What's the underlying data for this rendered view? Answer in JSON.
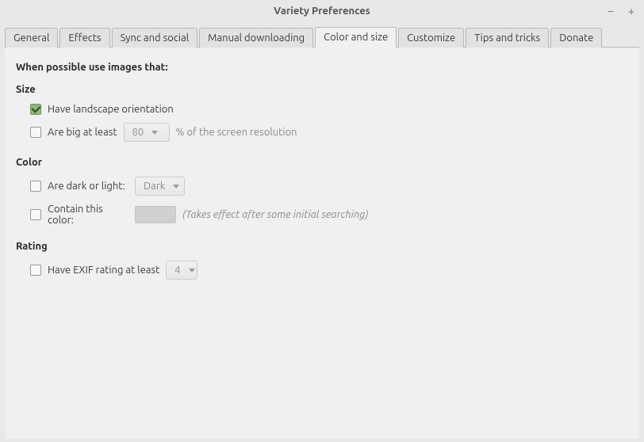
{
  "window": {
    "title": "Variety Preferences"
  },
  "tabs": [
    {
      "label": "General"
    },
    {
      "label": "Effects"
    },
    {
      "label": "Sync and social"
    },
    {
      "label": "Manual downloading"
    },
    {
      "label": "Color and size"
    },
    {
      "label": "Customize"
    },
    {
      "label": "Tips and tricks"
    },
    {
      "label": "Donate"
    }
  ],
  "heading": "When possible use images that:",
  "sections": {
    "size": {
      "title": "Size",
      "landscape_label": "Have landscape orientation",
      "big_label": "Are big at least",
      "big_value": "80",
      "big_hint": "% of the screen resolution"
    },
    "color": {
      "title": "Color",
      "dark_light_label": "Are dark or light:",
      "dark_light_value": "Dark",
      "contain_label": "Contain this color:",
      "contain_hint": "(Takes effect after some initial searching)"
    },
    "rating": {
      "title": "Rating",
      "exif_label": "Have EXIF rating at least",
      "exif_value": "4"
    }
  }
}
